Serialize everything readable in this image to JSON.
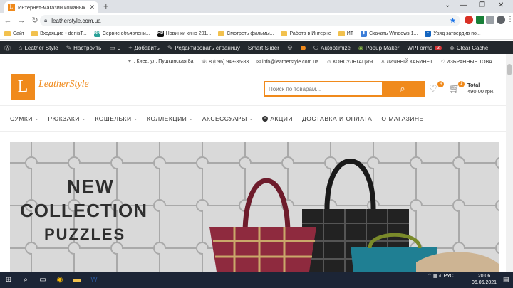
{
  "browser": {
    "tab_title": "Интернет-магазин кожаных из...",
    "url": "leatherstyle.com.ua"
  },
  "bookmarks": [
    {
      "label": "Сайт",
      "icon": "folder-icon"
    },
    {
      "label": "Входящие • denisT...",
      "icon": "folder-icon"
    },
    {
      "label": "Сервис объявлени...",
      "icon": "site-icon"
    },
    {
      "label": "Новинки кино 201...",
      "icon": "site-icon"
    },
    {
      "label": "Смотреть фильмы...",
      "icon": "folder-icon"
    },
    {
      "label": "Работа в Интерне",
      "icon": "folder-icon"
    },
    {
      "label": "ИТ",
      "icon": "folder-icon"
    },
    {
      "label": "Скачать Windows 1...",
      "icon": "site-icon"
    },
    {
      "label": "Уряд затвердив по...",
      "icon": "site-icon"
    }
  ],
  "adminbar": {
    "site_name": "Leather Style",
    "customize": "Настроить",
    "comments": "0",
    "add": "Добавить",
    "edit": "Редактировать страницу",
    "slider": "Smart Slider",
    "autoptimize": "Autoptimize",
    "popup": "Popup Maker",
    "wpforms": "WPForms",
    "wpforms_count": "2",
    "cache": "Clear Cache"
  },
  "infobar": {
    "address": "г. Киев, ул. Пушкинская 8а",
    "phone": "8 (096) 943-36-83",
    "email": "info@leatherstyle.com.ua",
    "consult": "КОНСУЛЬТАЦИЯ",
    "cabinet": "ЛИЧНЫЙ КАБИНЕТ",
    "favorites": "ИЗБРАННЫЕ ТОВА..."
  },
  "header": {
    "logo_letter": "L",
    "logo_text": "LeatherStyle",
    "search_placeholder": "Поиск по товарам...",
    "wishlist_count": "4",
    "cart_count": "1",
    "total_label": "Total",
    "total_value": "490.00 грн."
  },
  "menu": [
    {
      "label": "СУМКИ",
      "caret": true
    },
    {
      "label": "РЮКЗАКИ",
      "caret": true
    },
    {
      "label": "КОШЕЛЬКИ",
      "caret": true
    },
    {
      "label": "КОЛЛЕКЦИИ",
      "caret": true
    },
    {
      "label": "АКСЕССУАРЫ",
      "caret": true
    },
    {
      "label": "АКЦИИ",
      "caret": false
    },
    {
      "label": "ДОСТАВКА И ОПЛАТА",
      "caret": false
    },
    {
      "label": "О МАГАЗИНЕ",
      "caret": false
    }
  ],
  "banner": {
    "line1": "NEW",
    "line2": "COLLECTION",
    "line3": "PUZZLES"
  },
  "taskbar": {
    "lang": "РУС",
    "time": "20:06",
    "date": "06.06.2021"
  },
  "colors": {
    "accent": "#f08a1c",
    "admin_bg": "#23282d",
    "taskbar_bg": "#1c2536"
  }
}
